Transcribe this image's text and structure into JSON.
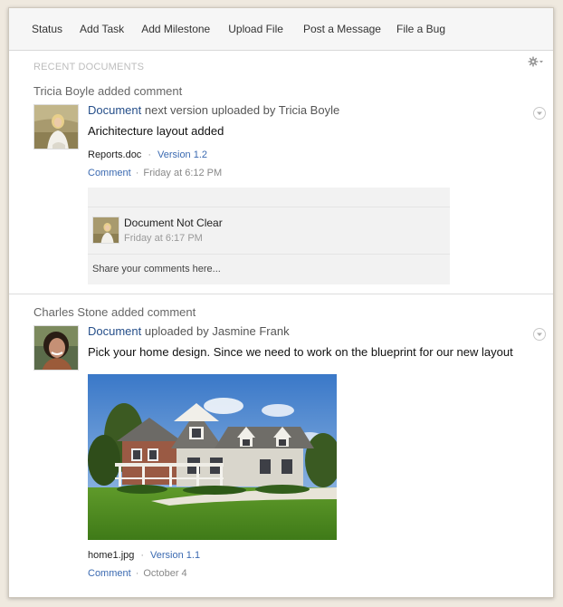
{
  "tabs": [
    "Status",
    "Add Task",
    "Add Milestone",
    "Upload File",
    "Post a Message",
    "File a Bug"
  ],
  "section_title": "RECENT DOCUMENTS",
  "icons": {
    "settings": "gear-icon",
    "expand": "chevron-down-circle-icon"
  },
  "activities": [
    {
      "heading": "Tricia Boyle added comment",
      "link": "Document",
      "action": " next version uploaded by Tricia Boyle",
      "message": "Arichitecture layout added",
      "file": "Reports.doc",
      "version": "Version 1.2",
      "comment_link": "Comment",
      "time": "Friday at 6:12 PM",
      "comments": [
        {
          "title": "Document Not Clear",
          "time": "Friday at 6:17 PM"
        }
      ],
      "comment_placeholder": "Share your comments here..."
    },
    {
      "heading": "Charles Stone added comment",
      "link": "Document",
      "action": " uploaded by Jasmine Frank",
      "message": "Pick your home design. Since we need to work on the blueprint for our new layout",
      "file": "home1.jpg",
      "version": "Version 1.1",
      "comment_link": "Comment",
      "time": "October 4"
    }
  ],
  "colors": {
    "link": "#264f8a",
    "meta_link": "#3b6ab1",
    "tab_bar": "#f6f6f6",
    "comment_bg": "#f2f2f2"
  }
}
